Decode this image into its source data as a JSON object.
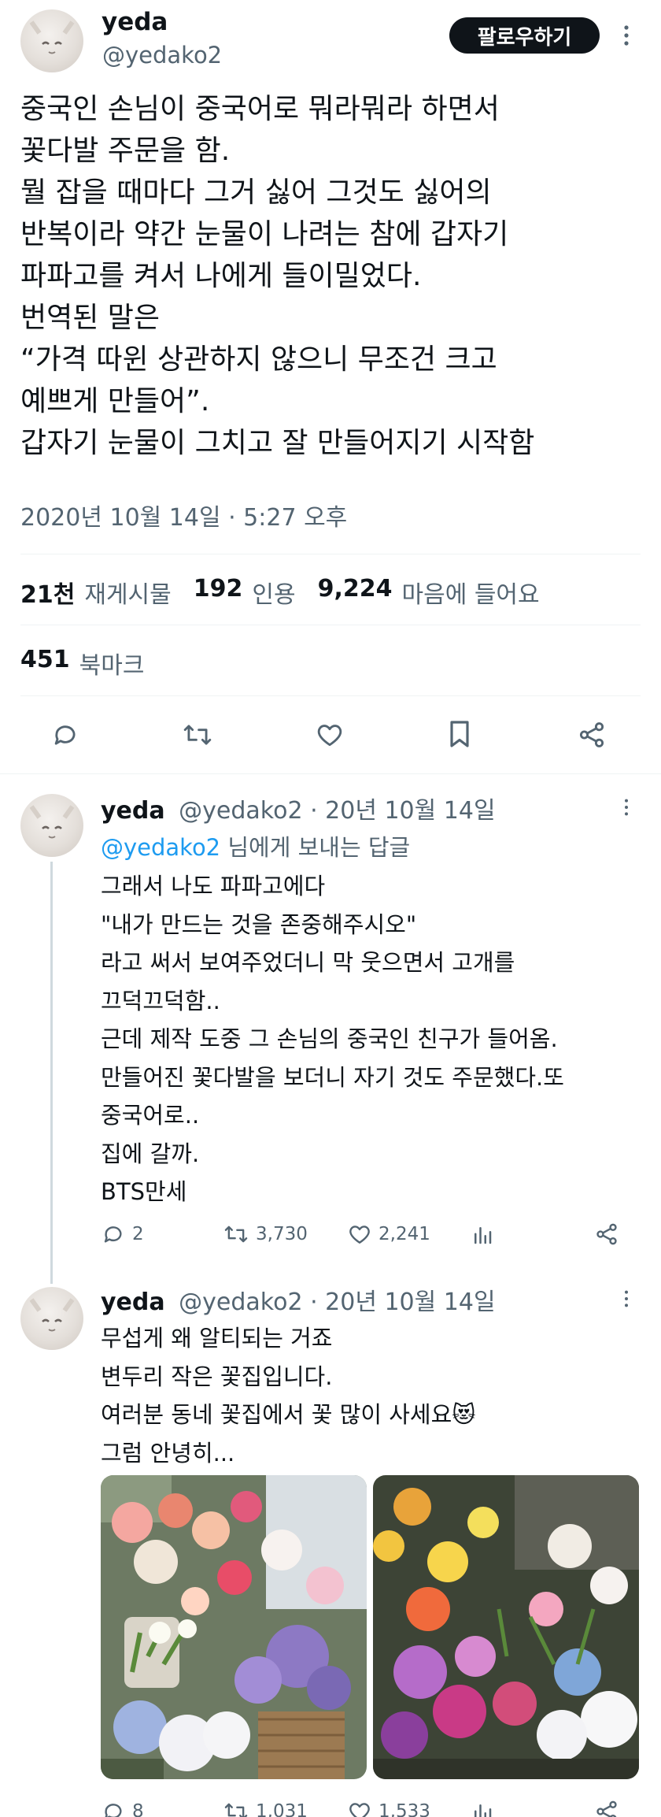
{
  "main_tweet": {
    "display_name": "yeda",
    "handle": "@yedako2",
    "follow_label": "팔로우하기",
    "text": "중국인 손님이 중국어로 뭐라뭐라 하면서\n꽃다발 주문을 함.\n뭘 잡을 때마다 그거 싫어 그것도 싫어의\n반복이라 약간 눈물이 나려는 참에 갑자기\n파파고를 켜서 나에게 들이밀었다.\n번역된 말은\n“가격 따윈 상관하지 않으니 무조건 크고\n예쁘게 만들어”.\n갑자기 눈물이 그치고 잘 만들어지기 시작함",
    "timestamp": "2020년 10월 14일 · 5:27 오후",
    "stats": {
      "retweets_num": "21천",
      "retweets_label": "재게시물",
      "quotes_num": "192",
      "quotes_label": "인용",
      "likes_num": "9,224",
      "likes_label": "마음에 들어요",
      "bookmarks_num": "451",
      "bookmarks_label": "북마크"
    }
  },
  "replies": [
    {
      "display_name": "yeda",
      "meta": "@yedako2 · 20년 10월 14일",
      "replying_to_handle": "@yedako2",
      "replying_to_suffix": " 님에게 보내는 답글",
      "text": "그래서 나도 파파고에다\n\"내가 만드는 것을 존중해주시오\"\n라고 써서 보여주었더니 막 웃으면서 고개를\n끄덕끄덕함..\n근데 제작 도중 그 손님의 중국인 친구가 들어옴.\n만들어진 꽃다발을 보더니 자기 것도 주문했다.또\n중국어로..\n집에 갈까.\nBTS만세",
      "replies_count": "2",
      "retweets_count": "3,730",
      "likes_count": "2,241"
    },
    {
      "display_name": "yeda",
      "meta": "@yedako2 · 20년 10월 14일",
      "text": "무섭게 왜 알티되는 거죠\n변두리 작은 꽃집입니다.\n여러분 동네 꽃집에서 꽃 많이 사세요😻\n그럼 안녕히...",
      "replies_count": "8",
      "retweets_count": "1,031",
      "likes_count": "1,533"
    }
  ],
  "icons": [
    "more-icon",
    "reply-icon",
    "retweet-icon",
    "like-icon",
    "bookmark-icon",
    "share-icon",
    "views-icon"
  ],
  "colors": {
    "text": "#0f1419",
    "muted": "#536471",
    "link": "#1d9bf0",
    "divider": "#eff3f4",
    "follow_bg": "#0f1419"
  }
}
